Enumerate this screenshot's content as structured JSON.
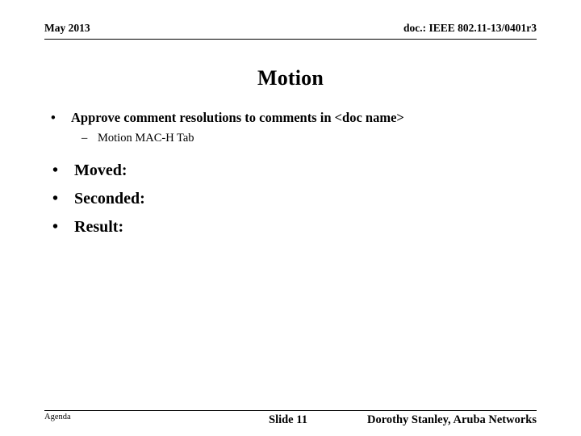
{
  "header": {
    "date": "May 2013",
    "doc": "doc.: IEEE 802.11-13/0401r3"
  },
  "title": "Motion",
  "bullets": {
    "level1_first": "Approve comment resolutions to comments in <doc name>",
    "level2_first": "Motion MAC-H Tab",
    "marker_level1": "•",
    "marker_level2": "–",
    "items_big": [
      "Moved:",
      "Seconded:",
      "Result:"
    ]
  },
  "footer": {
    "agenda": "Agenda",
    "slide": "Slide 11",
    "author": "Dorothy Stanley, Aruba Networks"
  }
}
